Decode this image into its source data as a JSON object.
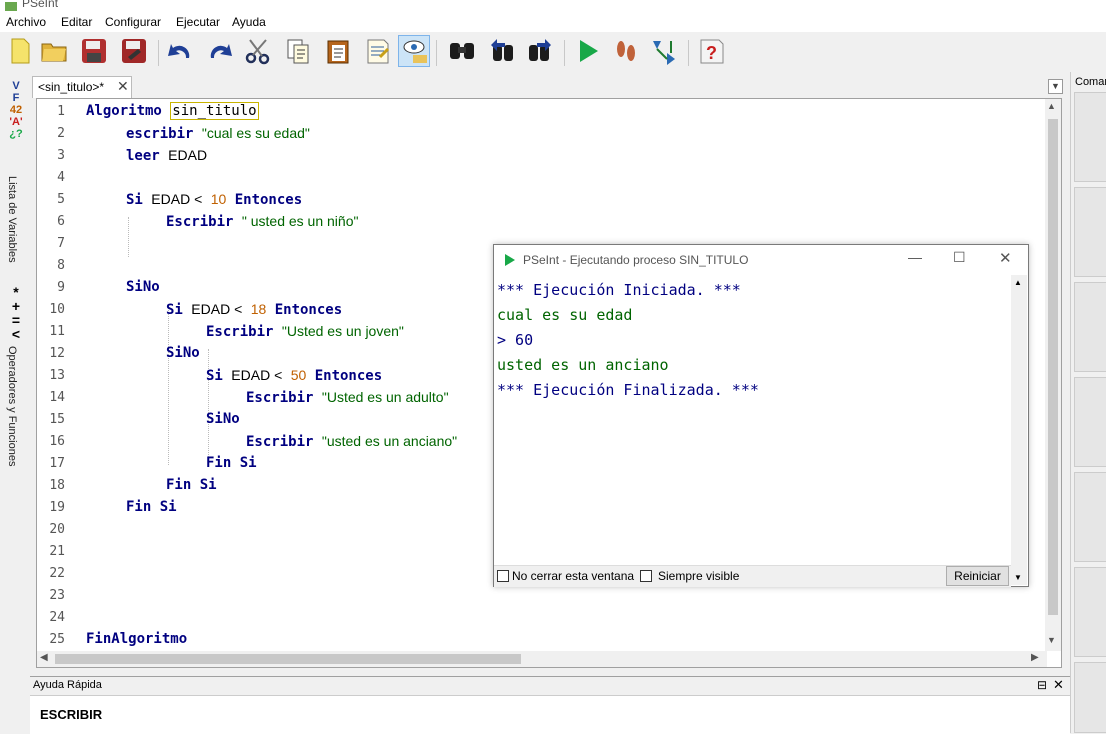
{
  "window": {
    "title": "PSeInt"
  },
  "menu": [
    "Archivo",
    "Editar",
    "Configurar",
    "Ejecutar",
    "Ayuda"
  ],
  "toolbar": {
    "icons": [
      "new-file-icon",
      "open-folder-icon",
      "save-icon",
      "save-as-icon",
      "undo-icon",
      "redo-icon",
      "cut-icon",
      "copy-icon",
      "paste-icon",
      "comment-icon",
      "uncomment-icon",
      "watch-variables-icon",
      "search-icon",
      "find-previous-icon",
      "find-next-icon",
      "run-icon",
      "step-by-step-icon",
      "flowchart-icon",
      "help-icon"
    ]
  },
  "left_panel": {
    "variables_label": "Lista de Variables",
    "operators_label": "Operadores y Funciones"
  },
  "editor": {
    "tab_label": "<sin_titulo>*",
    "line_numbers": [
      "1",
      "2",
      "3",
      "4",
      "5",
      "6",
      "7",
      "8",
      "9",
      "10",
      "11",
      "12",
      "13",
      "14",
      "15",
      "16",
      "17",
      "18",
      "19",
      "20",
      "21",
      "22",
      "23",
      "24",
      "25"
    ],
    "lines": {
      "l1_kw": "Algoritmo",
      "l1_name": "sin_titulo",
      "l2_kw": "escribir",
      "l2_str": "\"cual es su edad\"",
      "l3_kw": "leer",
      "l3_var": "EDAD",
      "l5_kw": "Si",
      "l5_var": "EDAD <",
      "l5_num": "10",
      "l5_kw2": "Entonces",
      "l6_kw": "Escribir",
      "l6_str": "\" usted es un niño\"",
      "l9_kw": "SiNo",
      "l10_kw": "Si",
      "l10_var": "EDAD <",
      "l10_num": "18",
      "l10_kw2": "Entonces",
      "l11_kw": "Escribir",
      "l11_str": "\"Usted es un joven\"",
      "l12_kw": "SiNo",
      "l13_kw": "Si",
      "l13_var": "EDAD <",
      "l13_num": "50",
      "l13_kw2": "Entonces",
      "l14_kw": "Escribir",
      "l14_str": "\"Usted es un adulto\"",
      "l15_kw": "SiNo",
      "l16_kw": "Escribir",
      "l16_str": "\"usted es un anciano\"",
      "l17_kw": "Fin Si",
      "l18_kw": "Fin Si",
      "l19_kw": "Fin Si",
      "l25_kw": "FinAlgoritmo"
    }
  },
  "console": {
    "title": "PSeInt - Ejecutando proceso SIN_TITULO",
    "output": [
      "*** Ejecución Iniciada. ***",
      "cual es su edad",
      "> 60",
      "usted es un anciano",
      "*** Ejecución Finalizada. ***"
    ],
    "no_cerrar_label": "No cerrar esta ventana",
    "siempre_visible_label": "Siempre visible",
    "reiniciar_label": "Reiniciar"
  },
  "right_panel": {
    "label": "Comandos"
  },
  "help": {
    "title": "Ayuda Rápida",
    "content": "ESCRIBIR"
  },
  "colors": {
    "keyword": "#000080",
    "string": "#006400",
    "number": "#c06000",
    "console_text": "#000080"
  }
}
